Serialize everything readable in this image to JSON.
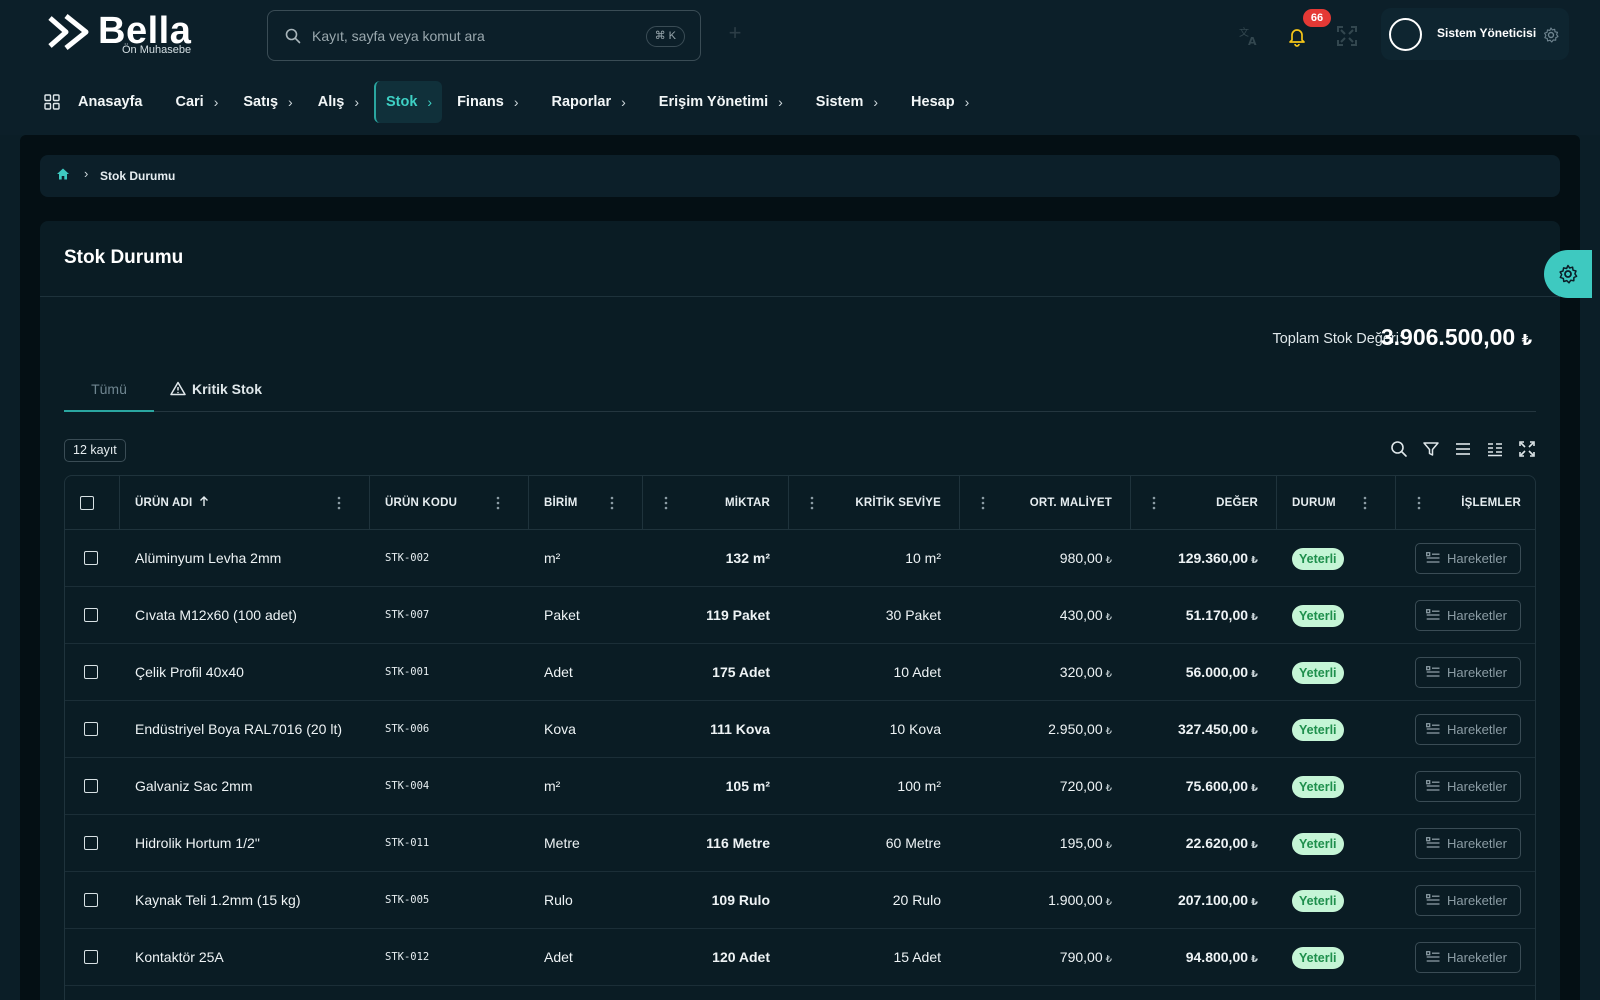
{
  "app": {
    "logo_text": "Bella",
    "logo_subtitle": "Ön Muhasebe"
  },
  "search": {
    "placeholder": "Kayıt, sayfa veya komut ara",
    "shortcut": "⌘ K"
  },
  "notifications": {
    "count": "66"
  },
  "user": {
    "name": "Sistem Yöneticisi"
  },
  "nav": {
    "items": [
      {
        "label": "Anasayfa",
        "has_chevron": false
      },
      {
        "label": "Cari",
        "has_chevron": true
      },
      {
        "label": "Satış",
        "has_chevron": true
      },
      {
        "label": "Alış",
        "has_chevron": true
      },
      {
        "label": "Stok",
        "has_chevron": true,
        "active": true
      },
      {
        "label": "Finans",
        "has_chevron": true
      },
      {
        "label": "Raporlar",
        "has_chevron": true
      },
      {
        "label": "Erişim Yönetimi",
        "has_chevron": true
      },
      {
        "label": "Sistem",
        "has_chevron": true
      },
      {
        "label": "Hesap",
        "has_chevron": true
      }
    ]
  },
  "breadcrumb": {
    "current": "Stok Durumu"
  },
  "page": {
    "title": "Stok Durumu",
    "total_label": "Toplam Stok Değeri:",
    "total_value": "3.906.500,00",
    "currency_symbol": "₺"
  },
  "tabs": {
    "all": "Tümü",
    "critical": "Kritik Stok"
  },
  "table": {
    "record_count": "12 kayıt",
    "columns": {
      "name": "ÜRÜN ADI",
      "code": "ÜRÜN KODU",
      "unit": "BİRİM",
      "quantity": "MİKTAR",
      "critical": "KRİTİK SEVİYE",
      "avg_cost": "ORT. MALİYET",
      "value": "DEĞER",
      "status": "DURUM",
      "actions": "İŞLEMLER"
    },
    "rows": [
      {
        "name": "Alüminyum Levha 2mm",
        "code": "STK-002",
        "unit": "m²",
        "quantity": "132 m²",
        "critical": "10 m²",
        "avg_cost": "980,00",
        "value": "129.360,00",
        "status": "Yeterli",
        "action": "Hareketler"
      },
      {
        "name": "Cıvata M12x60 (100 adet)",
        "code": "STK-007",
        "unit": "Paket",
        "quantity": "119 Paket",
        "critical": "30 Paket",
        "avg_cost": "430,00",
        "value": "51.170,00",
        "status": "Yeterli",
        "action": "Hareketler"
      },
      {
        "name": "Çelik Profil 40x40",
        "code": "STK-001",
        "unit": "Adet",
        "quantity": "175 Adet",
        "critical": "10 Adet",
        "avg_cost": "320,00",
        "value": "56.000,00",
        "status": "Yeterli",
        "action": "Hareketler"
      },
      {
        "name": "Endüstriyel Boya RAL7016 (20 lt)",
        "code": "STK-006",
        "unit": "Kova",
        "quantity": "111 Kova",
        "critical": "10 Kova",
        "avg_cost": "2.950,00",
        "value": "327.450,00",
        "status": "Yeterli",
        "action": "Hareketler"
      },
      {
        "name": "Galvaniz Sac 2mm",
        "code": "STK-004",
        "unit": "m²",
        "quantity": "105 m²",
        "critical": "100 m²",
        "avg_cost": "720,00",
        "value": "75.600,00",
        "status": "Yeterli",
        "action": "Hareketler"
      },
      {
        "name": "Hidrolik Hortum 1/2\"",
        "code": "STK-011",
        "unit": "Metre",
        "quantity": "116 Metre",
        "critical": "60 Metre",
        "avg_cost": "195,00",
        "value": "22.620,00",
        "status": "Yeterli",
        "action": "Hareketler"
      },
      {
        "name": "Kaynak Teli 1.2mm (15 kg)",
        "code": "STK-005",
        "unit": "Rulo",
        "quantity": "109 Rulo",
        "critical": "20 Rulo",
        "avg_cost": "1.900,00",
        "value": "207.100,00",
        "status": "Yeterli",
        "action": "Hareketler"
      },
      {
        "name": "Kontaktör 25A",
        "code": "STK-012",
        "unit": "Adet",
        "quantity": "120 Adet",
        "critical": "15 Adet",
        "avg_cost": "790,00",
        "value": "94.800,00",
        "status": "Yeterli",
        "action": "Hareketler"
      }
    ]
  },
  "colors": {
    "accent": "#3ec9c0",
    "background": "#0b1e27",
    "status_ok_bg": "#c5f5d6",
    "status_ok_text": "#1e8f4c",
    "badge": "#e53935"
  }
}
